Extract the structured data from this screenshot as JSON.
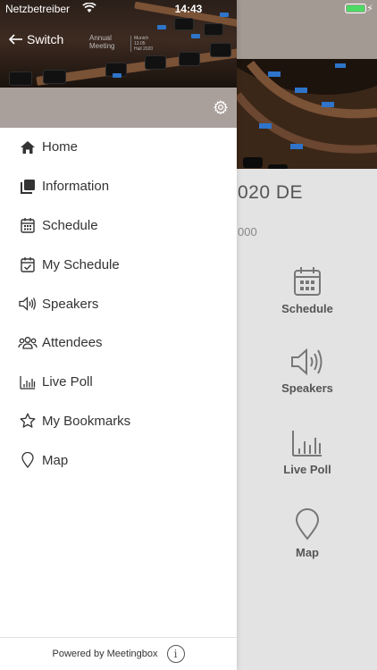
{
  "status_bar": {
    "carrier": "Netzbetreiber",
    "time": "14:43",
    "battery_color": "#4cd964"
  },
  "drawer": {
    "switch_label": "Switch",
    "poster": {
      "line1": "Annual",
      "line2": "Meeting",
      "right1": "Munich",
      "right2": "13.05",
      "right3": "Hall 2020"
    },
    "menu": [
      {
        "label": "Home",
        "icon": "home-icon"
      },
      {
        "label": "Information",
        "icon": "information-icon"
      },
      {
        "label": "Schedule",
        "icon": "calendar-icon"
      },
      {
        "label": "My Schedule",
        "icon": "calendar-check-icon"
      },
      {
        "label": "Speakers",
        "icon": "speaker-icon"
      },
      {
        "label": "Attendees",
        "icon": "attendees-icon"
      },
      {
        "label": "Live Poll",
        "icon": "bar-chart-icon"
      },
      {
        "label": "My Bookmarks",
        "icon": "star-icon"
      },
      {
        "label": "Map",
        "icon": "map-pin-icon"
      }
    ],
    "footer": {
      "powered_by": "Powered by Meetingbox",
      "info_glyph": "i"
    }
  },
  "background": {
    "event_title_partial": "020 DE",
    "event_subtitle_partial": "000",
    "tiles": [
      {
        "label": "Schedule",
        "icon": "calendar-icon"
      },
      {
        "label": "Speakers",
        "icon": "speaker-icon"
      },
      {
        "label": "Live Poll",
        "icon": "bar-chart-icon"
      },
      {
        "label": "Map",
        "icon": "map-pin-icon"
      }
    ]
  },
  "colors": {
    "header_bar": "#a49a94",
    "drawer_bar": "#aaa09b",
    "background_panel": "#e3e3e3"
  }
}
